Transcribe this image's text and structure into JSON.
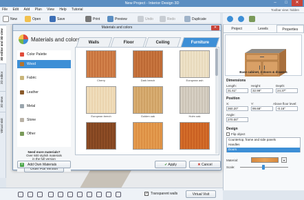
{
  "window": {
    "title": "New Project - Interior Design 3D"
  },
  "menu": [
    "File",
    "Edit",
    "Add",
    "Plan",
    "View",
    "Help",
    "Tutorial"
  ],
  "toolbar": {
    "new": "New",
    "open": "Open",
    "save": "Save",
    "print": "Print",
    "preview": "Preview",
    "undo": "Undo",
    "redo": "Redo",
    "duplicate": "Duplicate",
    "hidden_hint": "Toolbar view: hidden"
  },
  "left_tabs": [
    "3D editor and 3D view",
    "2D editor",
    "3D view",
    "Virtual visit"
  ],
  "dialog": {
    "title": "Materials and colors",
    "heading": "Materials and colors",
    "categories": [
      {
        "label": "Color Palette",
        "color": "#e04b3a"
      },
      {
        "label": "Wood",
        "color": "#b7742c"
      },
      {
        "label": "Fabric",
        "color": "#c9b57a"
      },
      {
        "label": "Leather",
        "color": "#8a5a2b"
      },
      {
        "label": "Metal",
        "color": "#9aa5ad"
      },
      {
        "label": "Stone",
        "color": "#b9b2a6"
      },
      {
        "label": "Other",
        "color": "#7a9a5a"
      }
    ],
    "selected_category": "Wood",
    "tabs": [
      "Walls",
      "Floor",
      "Ceiling",
      "Furniture"
    ],
    "active_tab": "Furniture",
    "swatches": [
      {
        "caption": "Cherry",
        "c1": "#c06a36",
        "c2": "#d98a52"
      },
      {
        "caption": "Dark beech",
        "c1": "#b5622f",
        "c2": "#cf7d45"
      },
      {
        "caption": "European ash",
        "c1": "#e4d5b5",
        "c2": "#f1e6cf"
      },
      {
        "caption": "European beech",
        "c1": "#e8d0a8",
        "c2": "#f3e2c3"
      },
      {
        "caption": "Golden oak",
        "c1": "#c99a5c",
        "c2": "#deb57b"
      },
      {
        "caption": "Holm oak",
        "c1": "#c5bdb0",
        "c2": "#ddd6ca"
      },
      {
        "caption": "",
        "c1": "#7a3f1c",
        "c2": "#94522a"
      },
      {
        "caption": "",
        "c1": "#d7883d",
        "c2": "#e9a356"
      },
      {
        "caption": "",
        "c1": "#c45a1e",
        "c2": "#d9742f"
      }
    ],
    "more": {
      "title": "Need more materials?",
      "text1": "Over 600 stylish materials",
      "text2": "in the full version",
      "order_label": "Order Full Version"
    },
    "add_own_label": "Add Own Materials",
    "apply_label": "Apply",
    "cancel_label": "Cancel"
  },
  "right_panel": {
    "tabs": [
      "Project",
      "Levels",
      "Properties"
    ],
    "active_tab": "Properties",
    "object_name": "Base cabinet, 2 doors & drawers",
    "dimensions": {
      "title": "Dimensions",
      "length_label": "Length:",
      "height_label": "Height:",
      "depth_label": "Depth:",
      "length": "31.61\"",
      "height": "32.99\"",
      "depth": "24.37\""
    },
    "position": {
      "title": "Position",
      "x_label": "X:",
      "y_label": "Y:",
      "above_label": "Above floor level:",
      "x": "360.20\"",
      "y": "99.68\"",
      "above": "-0.16\"",
      "angle_label": "Angle:",
      "angle": "270.00°"
    },
    "design": {
      "title": "Design",
      "flip_label": "Flip object",
      "parts": [
        "Countertop, frame and side panels",
        "Handles",
        "Doors"
      ],
      "selected_part": "Doors",
      "material_label": "Material:",
      "scale_label": "Scale:"
    }
  },
  "bottom": {
    "transparent_walls": "Transparent walls",
    "virtual_visit": "Virtual Visit"
  }
}
